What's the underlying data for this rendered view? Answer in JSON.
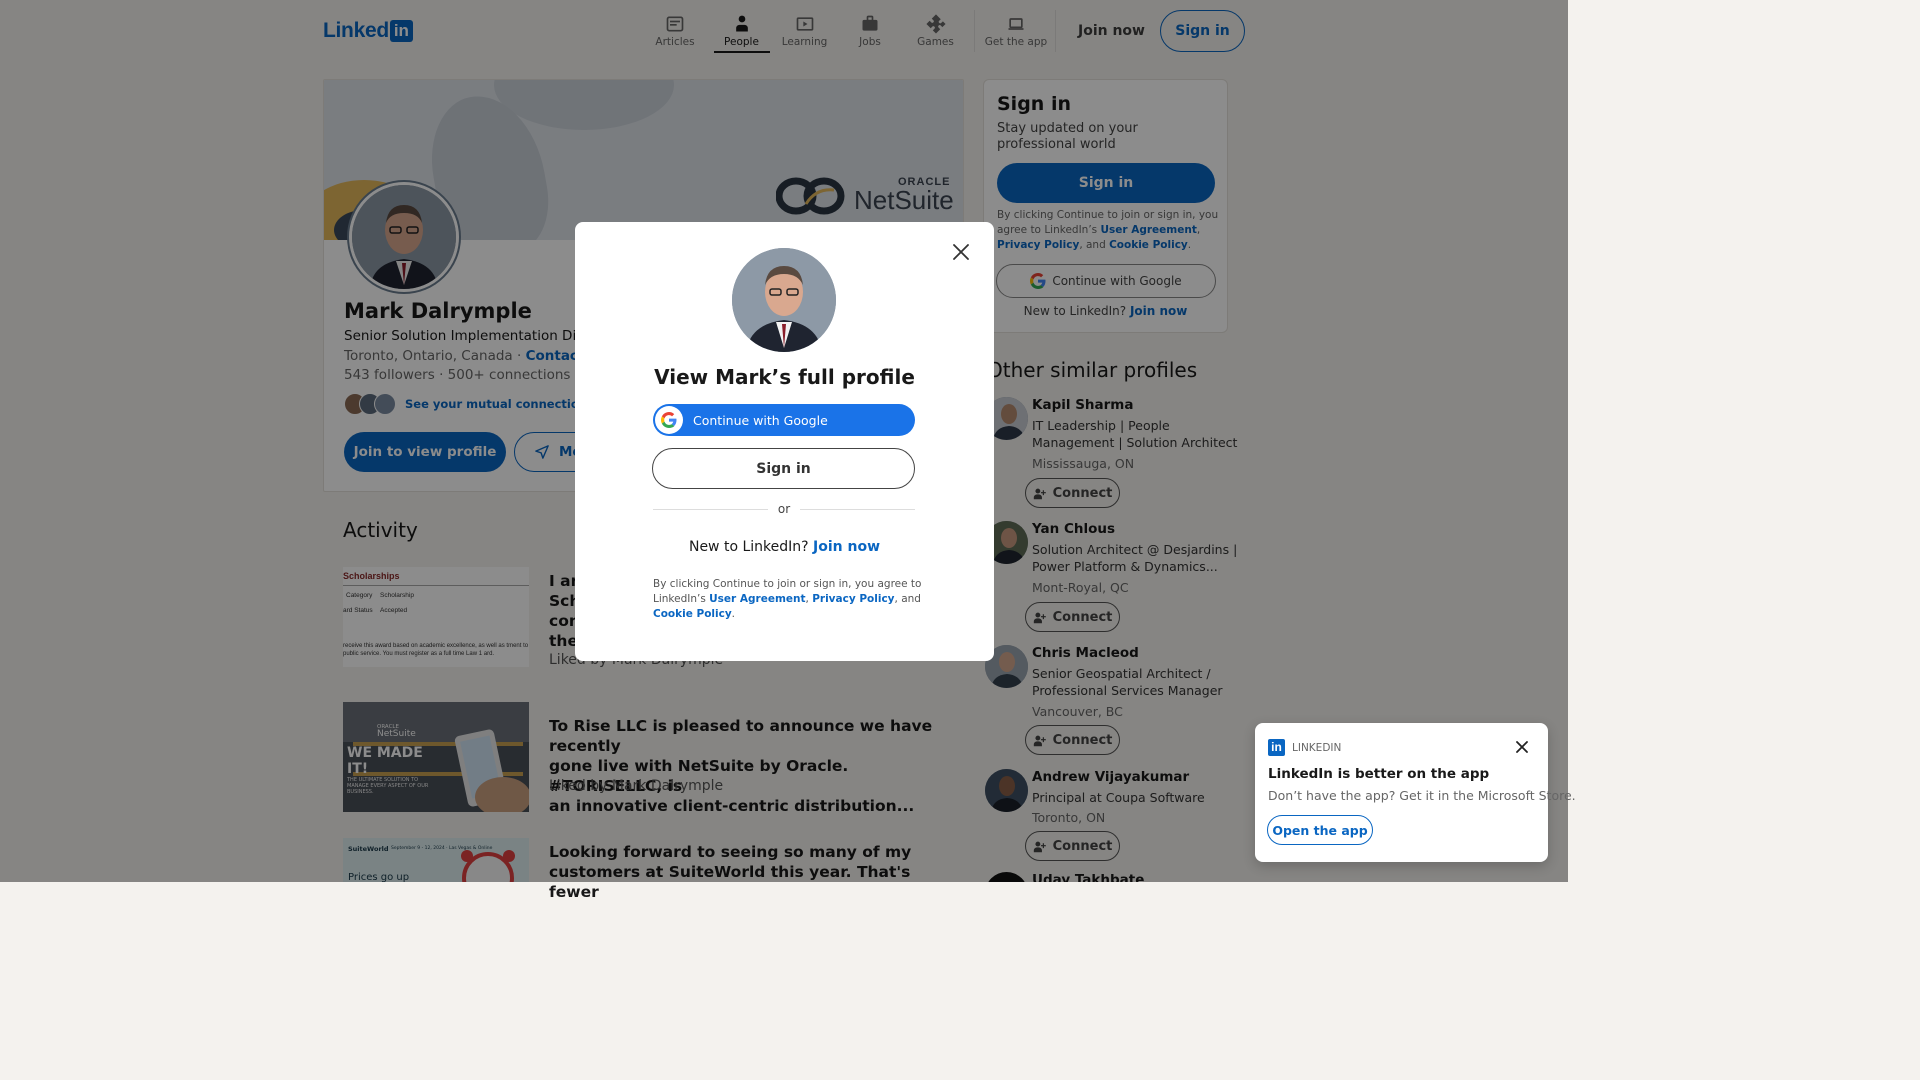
{
  "header": {
    "logo_text": "Linked",
    "logo_in": "in",
    "nav": [
      {
        "label": "Articles",
        "icon": "articles-icon"
      },
      {
        "label": "People",
        "icon": "people-icon"
      },
      {
        "label": "Learning",
        "icon": "learning-icon"
      },
      {
        "label": "Jobs",
        "icon": "jobs-icon"
      },
      {
        "label": "Games",
        "icon": "games-icon"
      },
      {
        "label": "Get the app",
        "icon": "laptop-icon"
      }
    ],
    "join_now": "Join now",
    "sign_in": "Sign in"
  },
  "profile": {
    "banner_brand_oracle": "ORACLE",
    "banner_brand_netsuite": "NetSuite",
    "name": "Mark Dalrymple",
    "headline": "Senior Solution Implementation Direc",
    "location": "Toronto, Ontario, Canada",
    "contact": "Contact I",
    "followers": "543 followers",
    "connections": "500+ connections",
    "mutual_link": "See your mutual connections",
    "join_button": "Join to view profile",
    "message_button": "Me"
  },
  "activity": {
    "title": "Activity",
    "items": [
      {
        "text": "I am ... Sch... com... the...",
        "line1": "I an",
        "line2": "Sch",
        "line3": "com",
        "line4": "the",
        "liked": "Liked by Mark Dalrymple",
        "thumb": {
          "heading": "Scholarships",
          "row1_label": "Category",
          "row1_value": "Scholarship",
          "row2_label": "ard Status",
          "row2_value": "Accepted",
          "body": "receive this award based on academic excellence, as well as tment to public service. You must register as a full time Law 1 ard."
        }
      },
      {
        "line1": "To Rise LLC is pleased to announce we have recently",
        "line2": "gone live with NetSuite by Oracle.   #TORISELLC, is",
        "line3": "an innovative client-centric distribution...",
        "liked": "Liked by Mark Dalrymple",
        "thumb": {
          "brand_oracle": "ORACLE",
          "brand_netsuite": "NetSuite",
          "headline": "WE MADE IT!",
          "sub": "THE ULTIMATE SOLUTION TO MANAGE EVERY ASPECT OF OUR BUSINESS."
        }
      },
      {
        "line1": "Looking forward to seeing so many of my",
        "line2": "customers at SuiteWorld this year. That's fewer",
        "thumb": {
          "brand": "SuiteWorld",
          "date": "September 9 - 12, 2024 · Las Vegas & Online",
          "text": "Prices go up"
        }
      }
    ]
  },
  "signin_card": {
    "title": "Sign in",
    "subtitle": "Stay updated on your professional world",
    "button": "Sign in",
    "legal_prefix": "By clicking Continue to join or sign in, you agree to LinkedIn’s ",
    "user_agreement": "User Agreement",
    "comma": ", ",
    "privacy_policy": "Privacy Policy",
    "and": ", and ",
    "cookie_policy": "Cookie Policy",
    "period": ".",
    "google": "Continue with Google",
    "new_prefix": "New to LinkedIn? ",
    "new_link": "Join now"
  },
  "similar": {
    "title": "Other similar profiles",
    "connect_label": "Connect",
    "profiles": [
      {
        "name": "Kapil Sharma",
        "headline": "IT Leadership | People Management | Solution Architect",
        "location": "Mississauga, ON"
      },
      {
        "name": "Yan Chlous",
        "headline": "Solution Architect @ Desjardins | Power Platform & Dynamics...",
        "location": "Mont-Royal, QC"
      },
      {
        "name": "Chris Macleod",
        "headline": "Senior Geospatial Architect / Professional Services Manager",
        "location": "Vancouver, BC"
      },
      {
        "name": "Andrew Vijayakumar",
        "headline": "Principal at Coupa Software",
        "location": "Toronto, ON"
      },
      {
        "name": "Uday Takhbate",
        "headline": "",
        "location": ""
      }
    ]
  },
  "modal": {
    "title": "View Mark’s full profile",
    "google": "Continue with Google",
    "sign_in": "Sign in",
    "or": "or",
    "new_prefix": "New to LinkedIn? ",
    "new_link": "Join now",
    "legal_prefix": "By clicking Continue to join or sign in, you agree to LinkedIn’s ",
    "user_agreement": "User Agreement",
    "comma": ", ",
    "privacy_policy": "Privacy Policy",
    "and": ", and ",
    "cookie_policy": "Cookie Policy",
    "period": "."
  },
  "toast": {
    "brand": "LINKEDIN",
    "brand_in": "in",
    "title": "LinkedIn is better on the app",
    "subtitle": "Don’t have the app? Get it in the Microsoft Store.",
    "button": "Open the app"
  },
  "colors": {
    "brand_blue": "#0a66c2",
    "google_blue": "#1a73e8",
    "page_bg": "#f4f2ee"
  }
}
